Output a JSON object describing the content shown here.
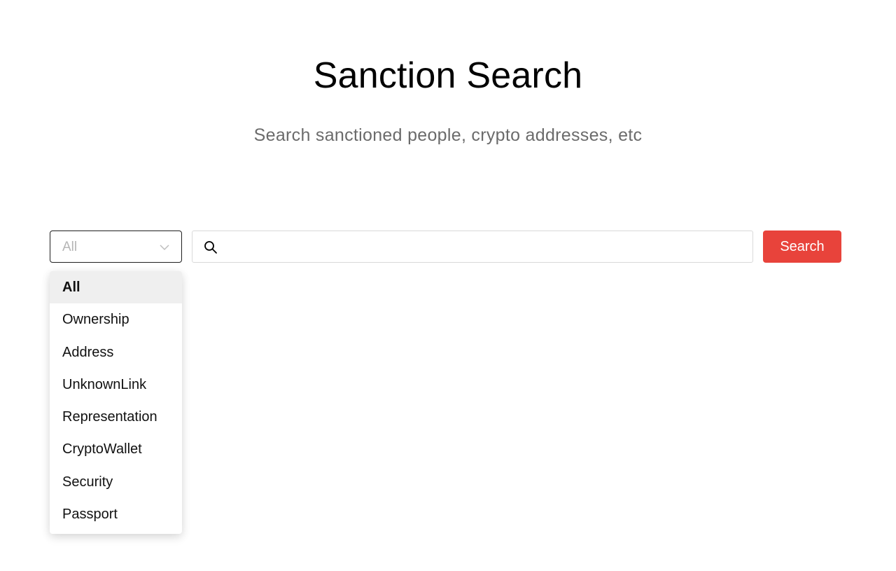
{
  "header": {
    "title": "Sanction Search",
    "subtitle": "Search sanctioned people, crypto addresses, etc"
  },
  "filter": {
    "selected": "All",
    "options": [
      "All",
      "Ownership",
      "Address",
      "UnknownLink",
      "Representation",
      "CryptoWallet",
      "Security",
      "Passport"
    ]
  },
  "search": {
    "value": "",
    "placeholder": "",
    "button_label": "Search",
    "icon": "search-icon"
  },
  "colors": {
    "accent": "#e8433b",
    "subtitle": "#6b6b6b",
    "selected_option_bg": "#efefef"
  }
}
